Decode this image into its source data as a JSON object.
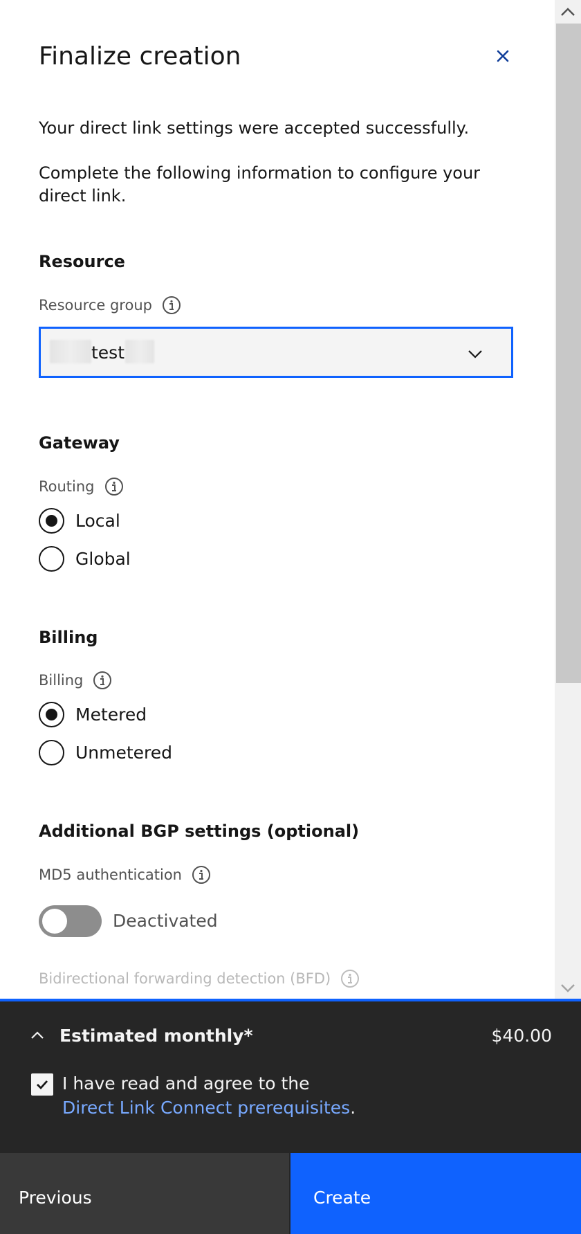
{
  "header": {
    "title": "Finalize creation"
  },
  "intro": {
    "line1": "Your direct link settings were accepted successfully.",
    "line2": "Complete the following information to configure your direct link."
  },
  "resource": {
    "heading": "Resource",
    "group_label": "Resource group",
    "group_value": "test"
  },
  "gateway": {
    "heading": "Gateway",
    "routing_label": "Routing",
    "options": [
      {
        "label": "Local",
        "checked": true
      },
      {
        "label": "Global",
        "checked": false
      }
    ]
  },
  "billing": {
    "heading": "Billing",
    "billing_label": "Billing",
    "options": [
      {
        "label": "Metered",
        "checked": true
      },
      {
        "label": "Unmetered",
        "checked": false
      }
    ]
  },
  "bgp": {
    "heading": "Additional BGP settings (optional)",
    "md5_label": "MD5 authentication",
    "md5_state": "Deactivated",
    "bfd_label": "Bidirectional forwarding detection (BFD)"
  },
  "footer": {
    "estimate_label": "Estimated monthly*",
    "estimate_price": "$40.00",
    "agree_prefix": "I have read and agree to the",
    "agree_link": "Direct Link Connect prerequisites",
    "agree_suffix": ".",
    "agree_checked": true,
    "previous_label": "Previous",
    "create_label": "Create"
  },
  "icons": {
    "close": "close-icon",
    "info": "information-icon",
    "chevron_down": "chevron-down-icon",
    "chevron_up": "chevron-up-icon",
    "check": "checkmark-icon"
  },
  "colors": {
    "accent": "#0f62fe",
    "link": "#78a9ff",
    "footer_bg": "#262626",
    "secondary_button": "#393939"
  }
}
